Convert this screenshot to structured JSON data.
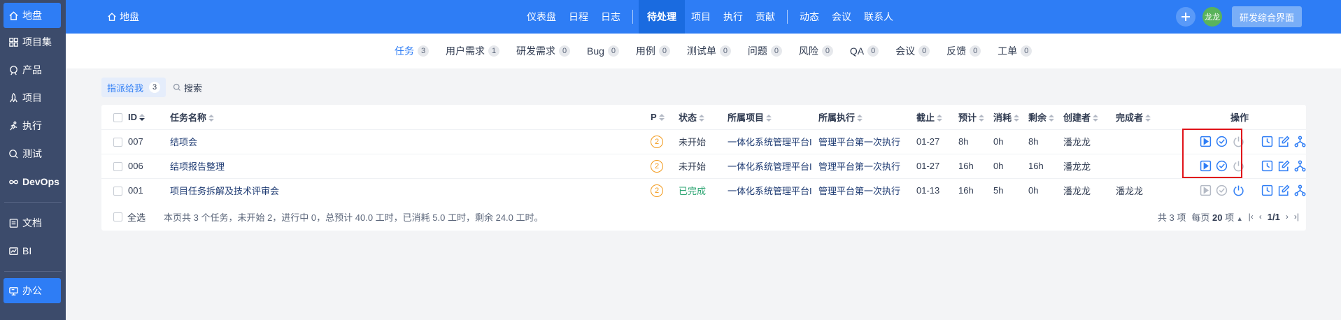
{
  "sidebar": {
    "items": [
      {
        "label": "地盘",
        "icon": "home-icon"
      },
      {
        "label": "项目集",
        "icon": "grid-icon"
      },
      {
        "label": "产品",
        "icon": "product-icon"
      },
      {
        "label": "项目",
        "icon": "project-icon"
      },
      {
        "label": "执行",
        "icon": "run-icon"
      },
      {
        "label": "测试",
        "icon": "test-icon"
      },
      {
        "label": "DevOps",
        "icon": "infinity-icon"
      },
      {
        "label": "文档",
        "icon": "document-icon"
      },
      {
        "label": "BI",
        "icon": "chart-icon"
      },
      {
        "label": "办公",
        "icon": "office-icon"
      }
    ]
  },
  "header": {
    "brand": "地盘",
    "nav": [
      "仪表盘",
      "日程",
      "日志",
      "待处理",
      "项目",
      "执行",
      "贡献",
      "动态",
      "会议",
      "联系人"
    ],
    "active_nav": "待处理",
    "avatar": "龙龙",
    "rd_button": "研发综合界面"
  },
  "subnav": {
    "tabs": [
      {
        "label": "任务",
        "count": "3"
      },
      {
        "label": "用户需求",
        "count": "1"
      },
      {
        "label": "研发需求",
        "count": "0"
      },
      {
        "label": "Bug",
        "count": "0"
      },
      {
        "label": "用例",
        "count": "0"
      },
      {
        "label": "测试单",
        "count": "0"
      },
      {
        "label": "问题",
        "count": "0"
      },
      {
        "label": "风险",
        "count": "0"
      },
      {
        "label": "QA",
        "count": "0"
      },
      {
        "label": "会议",
        "count": "0"
      },
      {
        "label": "反馈",
        "count": "0"
      },
      {
        "label": "工单",
        "count": "0"
      }
    ]
  },
  "filter": {
    "label": "指派给我",
    "count": "3",
    "search": "搜索"
  },
  "table": {
    "headers": {
      "id": "ID",
      "name": "任务名称",
      "pri": "P",
      "status": "状态",
      "project": "所属项目",
      "execution": "所属执行",
      "deadline": "截止",
      "estimate": "预计",
      "consumed": "消耗",
      "left": "剩余",
      "creator": "创建者",
      "finisher": "完成者",
      "actions": "操作"
    },
    "rows": [
      {
        "id": "007",
        "name": "结项会",
        "pri": "2",
        "status": "未开始",
        "project": "一体化系统管理平台I",
        "execution": "管理平台第一次执行",
        "deadline": "01-27",
        "estimate": "8h",
        "consumed": "0h",
        "left": "8h",
        "creator": "潘龙龙",
        "finisher": ""
      },
      {
        "id": "006",
        "name": "结项报告整理",
        "pri": "2",
        "status": "未开始",
        "project": "一体化系统管理平台I",
        "execution": "管理平台第一次执行",
        "deadline": "01-27",
        "estimate": "16h",
        "consumed": "0h",
        "left": "16h",
        "creator": "潘龙龙",
        "finisher": ""
      },
      {
        "id": "001",
        "name": "项目任务拆解及技术评审会",
        "pri": "2",
        "status": "已完成",
        "project": "一体化系统管理平台I",
        "execution": "管理平台第一次执行",
        "deadline": "01-13",
        "estimate": "16h",
        "consumed": "5h",
        "left": "0h",
        "creator": "潘龙龙",
        "finisher": "潘龙龙"
      }
    ],
    "footer": {
      "select_all": "全选",
      "summary": "本页共 3 个任务，未开始 2，进行中 0，总预计 40.0 工时，已消耗 5.0 工时，剩余 24.0 工时。",
      "total": "共 3 项",
      "per_page_prefix": "每页",
      "per_page": "20",
      "per_page_suffix": "项",
      "page": "1/1"
    }
  },
  "colors": {
    "primary": "#2e7df5",
    "sidebar": "#3c4b6b",
    "done": "#2ba471",
    "priority": "#f29a1c",
    "highlight": "#e0131a"
  }
}
